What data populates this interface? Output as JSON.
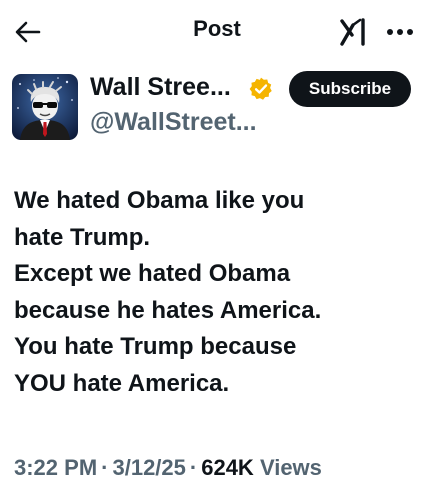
{
  "header": {
    "title": "Post",
    "icons": {
      "back": "back-arrow-icon",
      "grok": "grok-icon",
      "more": "more-dots-icon"
    }
  },
  "author": {
    "name": "Wall Stree...",
    "handle": "@WallStreet...",
    "verified_color": "#f5b400",
    "subscribe_label": "Subscribe"
  },
  "tweet": {
    "lines": [
      "We hated Obama like you",
      "hate Trump.",
      "Except we hated Obama",
      "because he hates America.",
      "You hate Trump because",
      "YOU hate America."
    ]
  },
  "meta": {
    "time": "3:22 PM",
    "date": "3/12/25",
    "views_count": "624K",
    "views_label": "Views",
    "separator": "·"
  },
  "colors": {
    "text": "#0f1419",
    "secondary": "#536471",
    "button_bg": "#0f1419",
    "button_text": "#ffffff"
  }
}
